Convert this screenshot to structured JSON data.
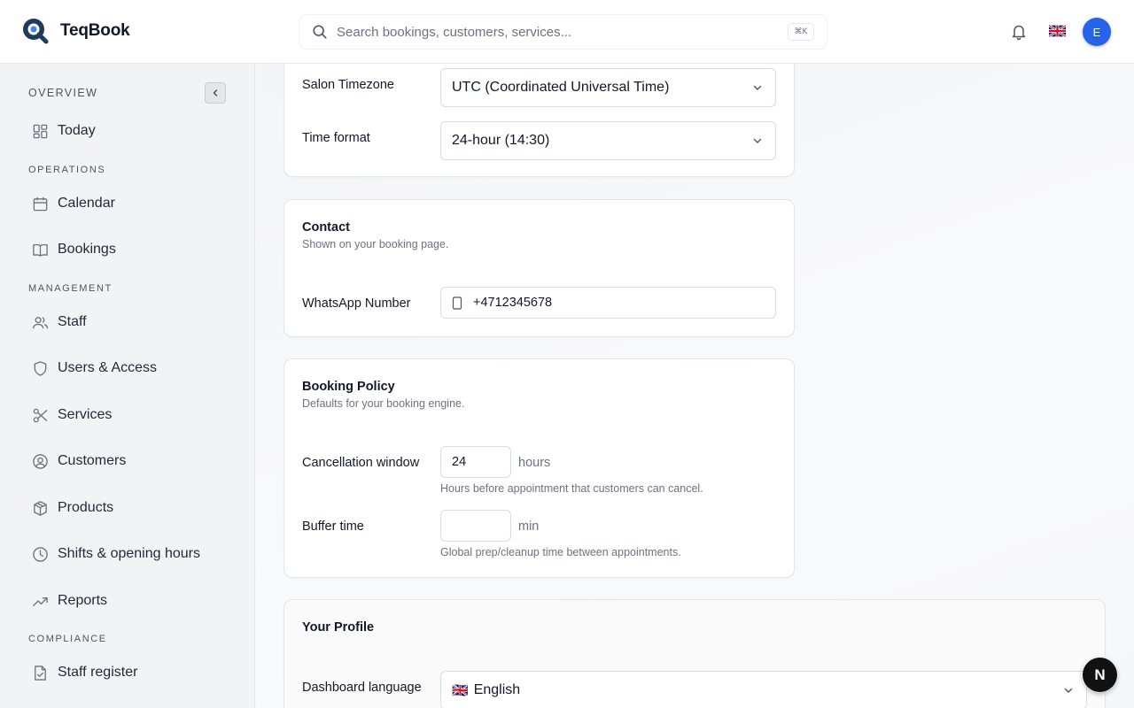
{
  "app": {
    "name": "TeqBook"
  },
  "header": {
    "search_placeholder": "Search bookings, customers, services...",
    "shortcut": "⌘K",
    "avatar_initial": "E",
    "language_flag": "uk-flag"
  },
  "sidebar": {
    "sections": {
      "overview": "OVERVIEW",
      "operations": "OPERATIONS",
      "management": "MANAGEMENT",
      "compliance": "COMPLIANCE"
    },
    "items": {
      "today": {
        "label": "Today",
        "icon": "dashboard-grid-icon"
      },
      "calendar": {
        "label": "Calendar",
        "icon": "calendar-icon"
      },
      "bookings": {
        "label": "Bookings",
        "icon": "book-open-icon"
      },
      "staff": {
        "label": "Staff",
        "icon": "users-icon"
      },
      "users_access": {
        "label": "Users & Access",
        "icon": "shield-icon"
      },
      "services": {
        "label": "Services",
        "icon": "scissors-icon"
      },
      "customers": {
        "label": "Customers",
        "icon": "user-circle-icon"
      },
      "products": {
        "label": "Products",
        "icon": "package-icon"
      },
      "shifts": {
        "label": "Shifts & opening hours",
        "icon": "clock-icon"
      },
      "reports": {
        "label": "Reports",
        "icon": "trending-up-icon"
      },
      "staff_register": {
        "label": "Staff register",
        "icon": "file-check-icon"
      }
    }
  },
  "general": {
    "timezone_label": "Salon Timezone",
    "timezone_value": "UTC (Coordinated Universal Time)",
    "time_format_label": "Time format",
    "time_format_value": "24-hour (14:30)"
  },
  "contact": {
    "title": "Contact",
    "subtitle": "Shown on your booking page.",
    "whatsapp_label": "WhatsApp Number",
    "whatsapp_value": "+4712345678"
  },
  "booking_policy": {
    "title": "Booking Policy",
    "subtitle": "Defaults for your booking engine.",
    "cancellation_label": "Cancellation window",
    "cancellation_value": "24",
    "cancellation_unit": "hours",
    "cancellation_help": "Hours before appointment that customers can cancel.",
    "buffer_label": "Buffer time",
    "buffer_value": "",
    "buffer_unit": "min",
    "buffer_help": "Global prep/cleanup time between appointments."
  },
  "profile": {
    "title": "Your Profile",
    "language_label": "Dashboard language",
    "language_flag": "🇬🇧",
    "language_value": "English"
  },
  "floating": {
    "label": "N"
  },
  "colors": {
    "accent": "#2563eb",
    "logo": "#1e3a5f"
  }
}
